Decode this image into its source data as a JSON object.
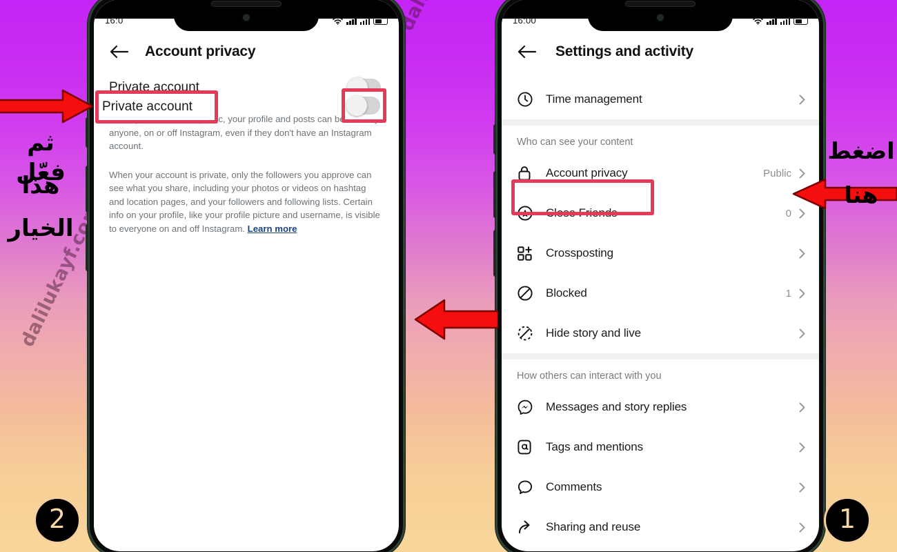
{
  "meta": {
    "watermark": "dalilukayf.com",
    "accent_red": "#e33b5a",
    "arrow_red": "#f40e0e",
    "bg_gradient_top": "#c424f5",
    "bg_gradient_bottom": "#f9d79b"
  },
  "steps": {
    "first": "①",
    "second": "②",
    "first_num": "1",
    "second_num": "2"
  },
  "annotations": {
    "left_arabic_lines": [
      "ثم فعّل",
      "هذا",
      "الخيار"
    ],
    "left_arabic_full": "ثم فعّل هذا الخيار",
    "right_arabic_lines": [
      "اضغط",
      "هنا"
    ],
    "right_arabic_full": "اضغط هنا"
  },
  "phone_left": {
    "status": {
      "time": "16:0",
      "wifi": "wifi-icon",
      "signal1": "signal-bars",
      "signal2": "signal-bars",
      "battery": "battery-icon"
    },
    "header": {
      "back": "back-arrow",
      "title": "Account privacy"
    },
    "toggle_row": {
      "label": "Private account",
      "state": "off"
    },
    "paragraphs": [
      "When your account is public, your profile and posts can be seen by anyone, on or off Instagram, even if they don't have an Instagram account.",
      "When your account is private, only the followers you approve can see what you share, including your photos or videos on hashtag and location pages, and your followers and following lists. Certain info on your profile, like your profile picture and username, is visible to everyone on and off Instagram. "
    ],
    "learn_more": "Learn more"
  },
  "phone_right": {
    "status": {
      "time": "16:00"
    },
    "header": {
      "back": "back-arrow",
      "title": "Settings and activity"
    },
    "top_item": {
      "label": "Time management",
      "icon": "clock-icon",
      "value": ""
    },
    "sections": [
      {
        "title": "Who can see your content",
        "items": [
          {
            "label": "Account privacy",
            "icon": "lock-icon",
            "value": "Public",
            "highlighted": true
          },
          {
            "label": "Close Friends",
            "icon": "star-circle-icon",
            "value": "0"
          },
          {
            "label": "Crossposting",
            "icon": "crosspost-icon",
            "value": ""
          },
          {
            "label": "Blocked",
            "icon": "block-icon",
            "value": "1"
          },
          {
            "label": "Hide story and live",
            "icon": "hide-story-icon",
            "value": ""
          }
        ]
      },
      {
        "title": "How others can interact with you",
        "items": [
          {
            "label": "Messages and story replies",
            "icon": "messenger-icon",
            "value": ""
          },
          {
            "label": "Tags and mentions",
            "icon": "at-icon",
            "value": ""
          },
          {
            "label": "Comments",
            "icon": "comment-icon",
            "value": ""
          },
          {
            "label": "Sharing and reuse",
            "icon": "share-icon",
            "value": ""
          }
        ]
      }
    ]
  }
}
